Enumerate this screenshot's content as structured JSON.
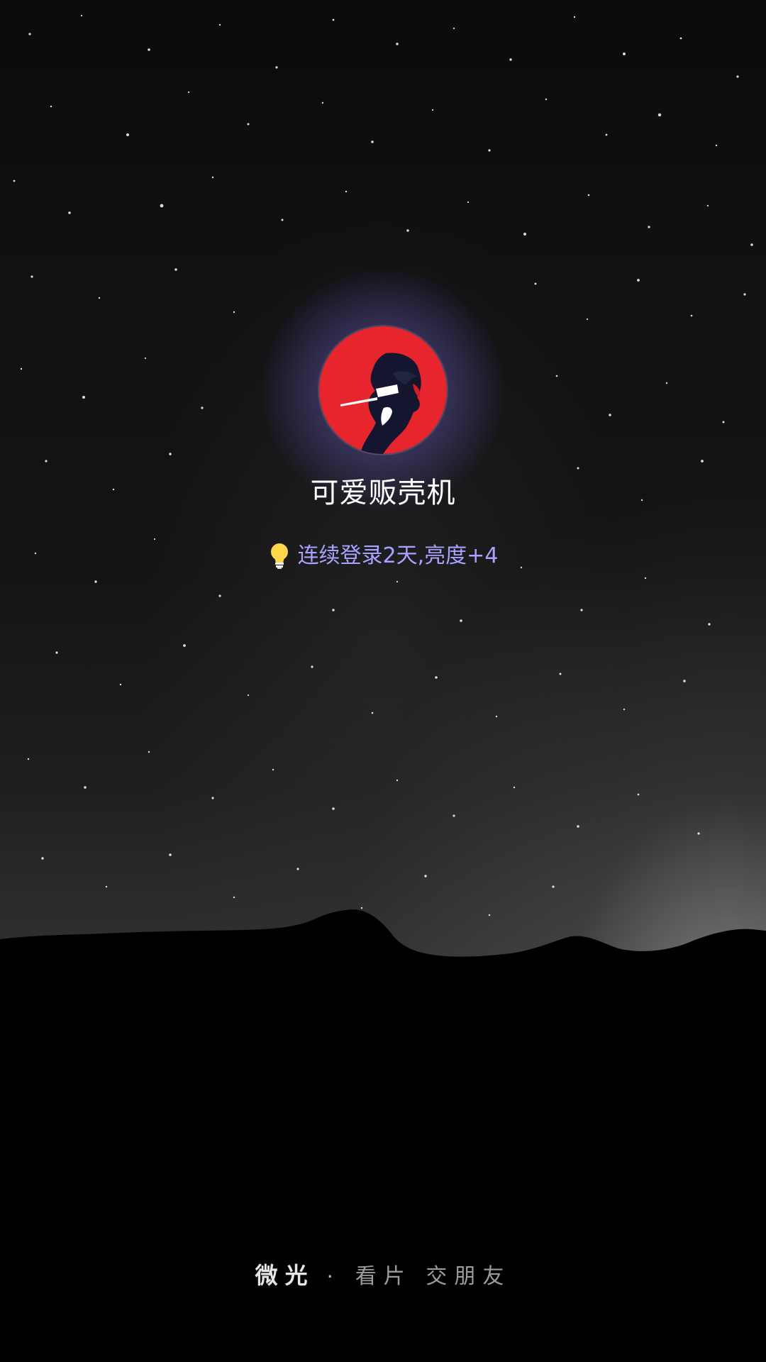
{
  "background": {
    "scene": "starry-night-sky-over-mountains"
  },
  "profile": {
    "avatar_icon": "red-circle-anime-portrait-avatar",
    "username": "可爱贩壳机"
  },
  "login_streak": {
    "icon": "lightbulb-icon",
    "text": "连续登录2天,亮度+4",
    "color": "#a7a3ff"
  },
  "footer": {
    "brand": "微光",
    "separator": "·",
    "slogan": "看片 交朋友"
  }
}
